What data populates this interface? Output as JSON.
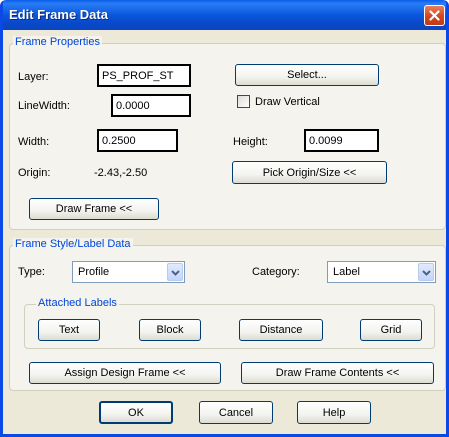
{
  "window": {
    "title": "Edit Frame Data"
  },
  "frame_properties": {
    "legend": "Frame Properties",
    "layer_label": "Layer:",
    "layer_value": "PS_PROF_ST",
    "select_button": "Select...",
    "linewidth_label": "LineWidth:",
    "linewidth_value": "0.0000",
    "draw_vertical_label": "Draw Vertical",
    "draw_vertical_checked": false,
    "width_label": "Width:",
    "width_value": "0.2500",
    "height_label": "Height:",
    "height_value": "0.0099",
    "origin_label": "Origin:",
    "origin_value": "-2.43,-2.50",
    "pick_origin_button": "Pick Origin/Size <<",
    "draw_frame_button": "Draw Frame <<"
  },
  "frame_style": {
    "legend": "Frame Style/Label Data",
    "type_label": "Type:",
    "type_value": "Profile",
    "category_label": "Category:",
    "category_value": "Label",
    "attached_labels": {
      "legend": "Attached Labels",
      "text_button": "Text",
      "block_button": "Block",
      "distance_button": "Distance",
      "grid_button": "Grid"
    },
    "assign_design_frame_button": "Assign Design Frame <<",
    "draw_frame_contents_button": "Draw Frame Contents <<"
  },
  "footer": {
    "ok_button": "OK",
    "cancel_button": "Cancel",
    "help_button": "Help"
  },
  "icons": {
    "close": "close-icon",
    "dropdown": "chevron-down-icon"
  },
  "colors": {
    "title_bar": "#0a57dc",
    "group_legend_text": "#0046d5",
    "close_button": "#d2451f",
    "dialog_background": "#ece9d8"
  }
}
